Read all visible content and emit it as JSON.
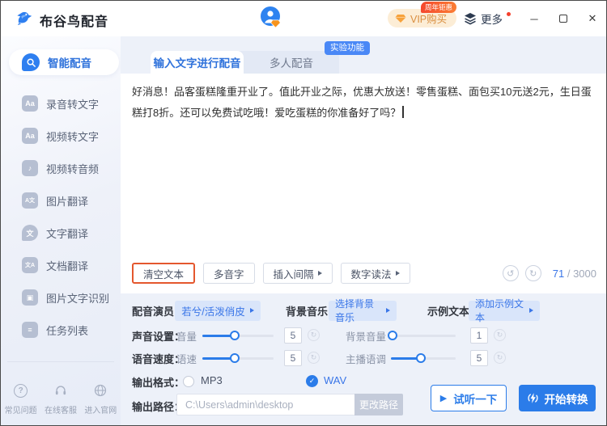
{
  "app": {
    "title": "布谷鸟配音"
  },
  "titlebar": {
    "vip_label": "VIP购买",
    "vip_badge": "周年钜惠",
    "more_label": "更多",
    "minimize": "─",
    "close": "✕"
  },
  "sidebar": {
    "items": [
      {
        "label": "智能配音",
        "active": true
      },
      {
        "label": "录音转文字"
      },
      {
        "label": "视频转文字"
      },
      {
        "label": "视频转音频"
      },
      {
        "label": "图片翻译"
      },
      {
        "label": "文字翻译"
      },
      {
        "label": "文档翻译"
      },
      {
        "label": "图片文字识别"
      },
      {
        "label": "任务列表"
      }
    ],
    "footer": [
      {
        "label": "常见问题"
      },
      {
        "label": "在线客服"
      },
      {
        "label": "进入官网"
      }
    ]
  },
  "tabs": {
    "tab1": "输入文字进行配音",
    "tab2": "多人配音",
    "experimental_badge": "实验功能"
  },
  "editor": {
    "text": "好消息！品客蛋糕隆重开业了。值此开业之际，优惠大放送！零售蛋糕、面包买10元送2元，生日蛋糕打8折。还可以免费试吃哦！爱吃蛋糕的你准备好了吗？",
    "char_count": "71",
    "char_limit": "/ 3000",
    "toolbar": {
      "clear": "清空文本",
      "polyphonic": "多音字",
      "insert_pause": "插入间隔",
      "number_reading": "数字读法"
    }
  },
  "settings": {
    "voice_label": "配音演员：",
    "voice_value": "若兮/活泼俏皮",
    "bgm_label": "背景音乐",
    "bgm_value": "选择背景音乐",
    "sample_label": "示例文本",
    "sample_value": "添加示例文本",
    "sound_label": "声音设置：",
    "volume_label": "音量",
    "volume_value": "5",
    "bg_volume_label": "背景音量",
    "bg_volume_value": "1",
    "speed_row_label": "语音速度：",
    "speed_label": "语速",
    "speed_value": "5",
    "tone_label": "主播语调",
    "tone_value": "5",
    "format_label": "输出格式：",
    "format_mp3": "MP3",
    "format_wav": "WAV",
    "path_label": "输出路径：",
    "path_value": "C:\\Users\\admin\\desktop",
    "change_path": "更改路径"
  },
  "actions": {
    "preview": "试听一下",
    "convert": "开始转换"
  },
  "icons": {
    "audio_to_text": "Aa",
    "video_to_text": "Aa",
    "video_to_audio": "♪",
    "image_translate": "A文",
    "text_translate": "文",
    "doc_translate": "文A",
    "ocr": "▣",
    "task_list": "≡",
    "faq": "?",
    "undo": "↺",
    "redo": "↻",
    "reset": "↻",
    "play": "▶",
    "radio_check": "✓"
  },
  "colors": {
    "primary": "#2B7CE9",
    "highlight_orange": "#E4572E",
    "badge_red": "#F5472E",
    "vip_text": "#D98E3F",
    "main_bg": "#EDF1F9"
  }
}
